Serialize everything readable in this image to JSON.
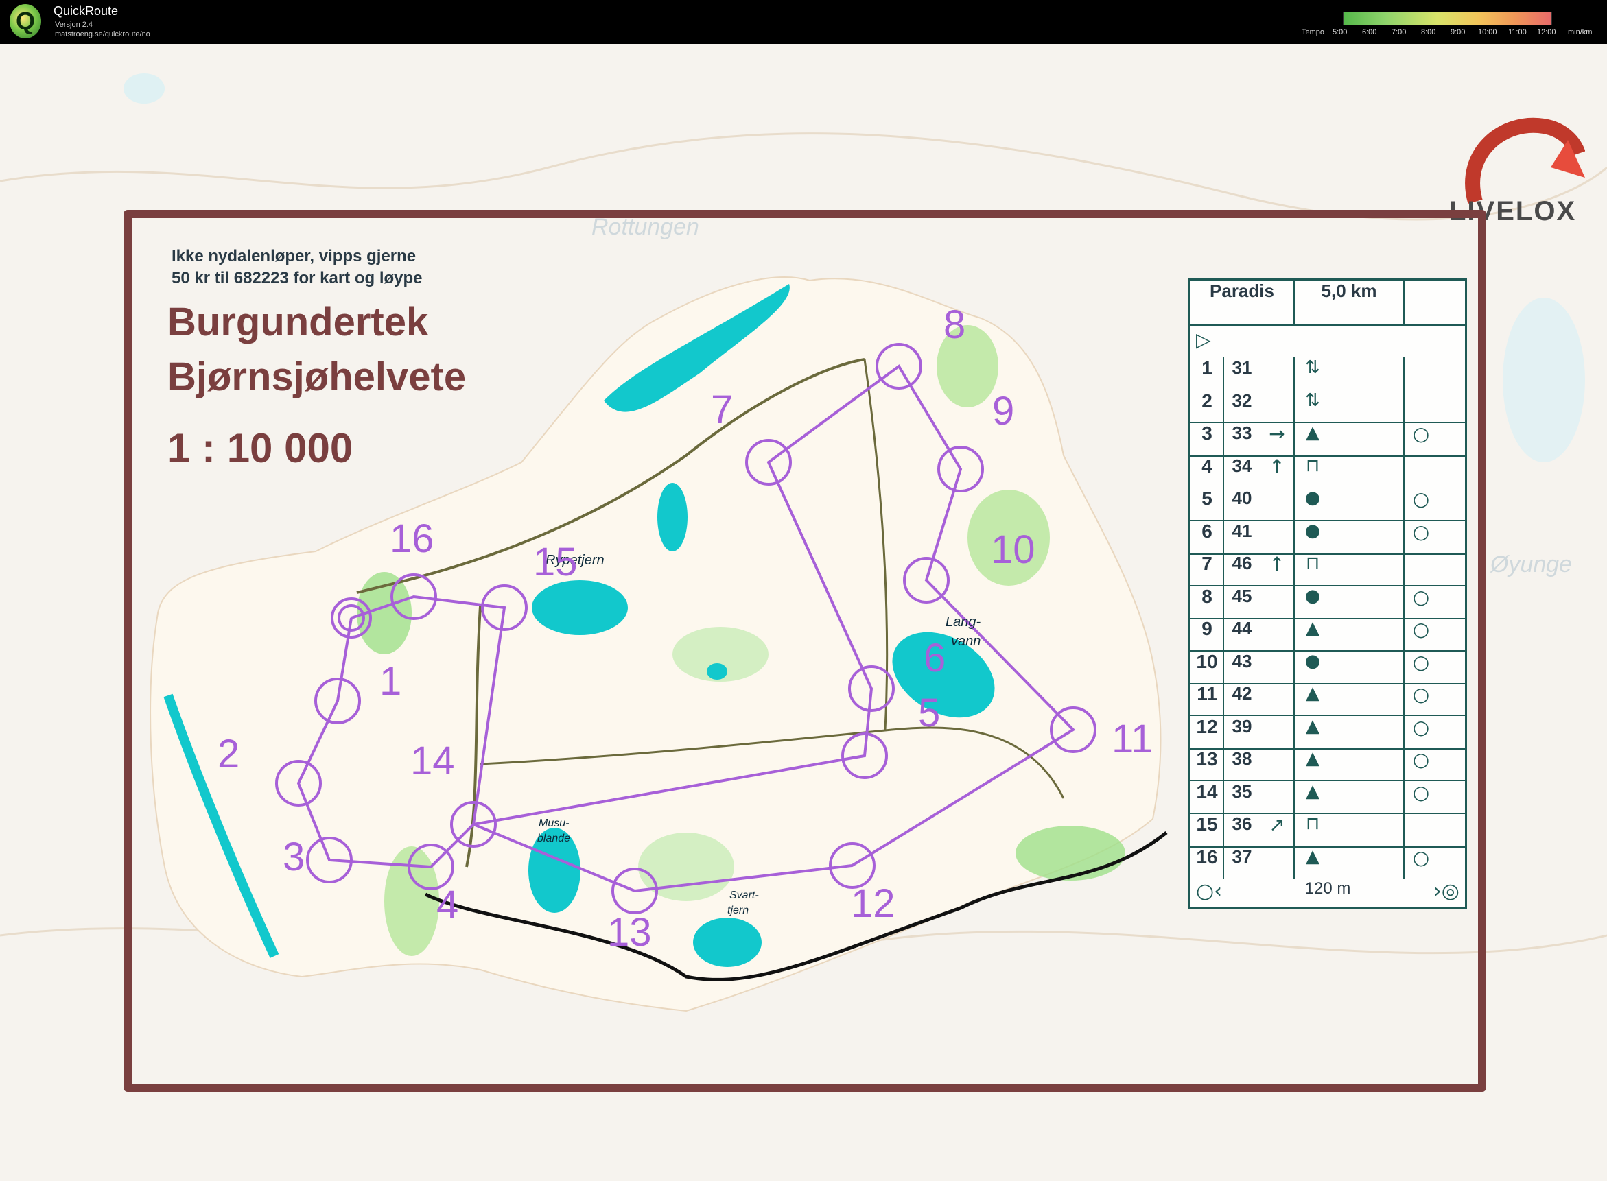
{
  "app": {
    "name": "QuickRoute",
    "version": "Versjon 2.4",
    "url": "matstroeng.se/quickroute/no",
    "logo_letter": "Q"
  },
  "tempo": {
    "label": "Tempo",
    "ticks": [
      "5:00",
      "6:00",
      "7:00",
      "8:00",
      "9:00",
      "10:00",
      "11:00",
      "12:00"
    ],
    "unit": "min/km"
  },
  "brand": {
    "name": "LIVELOX"
  },
  "map": {
    "note_line1": "Ikke nydalenløper, vipps gjerne",
    "note_line2": "50 kr til 682223 for kart og løype",
    "title": "Burgundertek",
    "subtitle": "Bjørnsjøhelvete",
    "scale": "1 : 10 000",
    "lake_labels": [
      "Rypetjern",
      "Lang-",
      "vann",
      "Musu-",
      "blande",
      "Svart-",
      "tjern"
    ],
    "background_labels": [
      "Rottungen",
      "Øyunge"
    ],
    "control_numbers": [
      "1",
      "2",
      "3",
      "4",
      "5",
      "6",
      "7",
      "8",
      "9",
      "10",
      "11",
      "12",
      "13",
      "14",
      "15",
      "16"
    ]
  },
  "description": {
    "course": "Paradis",
    "length": "5,0 km",
    "start_symbol": "▷",
    "rows": [
      {
        "n": "1",
        "code": "31",
        "dir": "",
        "feat": "⇅",
        "loc": ""
      },
      {
        "n": "2",
        "code": "32",
        "dir": "",
        "feat": "⇅",
        "loc": ""
      },
      {
        "n": "3",
        "code": "33",
        "dir": "→",
        "feat": "▲",
        "loc": "○"
      },
      {
        "n": "4",
        "code": "34",
        "dir": "↑",
        "feat": "⊓",
        "loc": ""
      },
      {
        "n": "5",
        "code": "40",
        "dir": "",
        "feat": "●",
        "loc": "○"
      },
      {
        "n": "6",
        "code": "41",
        "dir": "",
        "feat": "●",
        "loc": "○"
      },
      {
        "n": "7",
        "code": "46",
        "dir": "↑",
        "feat": "⊓",
        "loc": ""
      },
      {
        "n": "8",
        "code": "45",
        "dir": "",
        "feat": "●",
        "loc": "○"
      },
      {
        "n": "9",
        "code": "44",
        "dir": "",
        "feat": "▲",
        "loc": "○"
      },
      {
        "n": "10",
        "code": "43",
        "dir": "",
        "feat": "●",
        "loc": "○"
      },
      {
        "n": "11",
        "code": "42",
        "dir": "",
        "feat": "▲",
        "loc": "○"
      },
      {
        "n": "12",
        "code": "39",
        "dir": "",
        "feat": "▲",
        "loc": "○"
      },
      {
        "n": "13",
        "code": "38",
        "dir": "",
        "feat": "▲",
        "loc": "○"
      },
      {
        "n": "14",
        "code": "35",
        "dir": "",
        "feat": "▲",
        "loc": "○"
      },
      {
        "n": "15",
        "code": "36",
        "dir": "↗",
        "feat": "⊓",
        "loc": ""
      },
      {
        "n": "16",
        "code": "37",
        "dir": "",
        "feat": "▲",
        "loc": "○"
      }
    ],
    "footer_distance": "120 m",
    "footer_left_symbol": "○‹",
    "footer_right_symbol": "›◎"
  },
  "colors": {
    "frame": "#7a3f3f",
    "course": "#a760d8",
    "water": "#12c8cc",
    "table": "#1f5a55"
  }
}
